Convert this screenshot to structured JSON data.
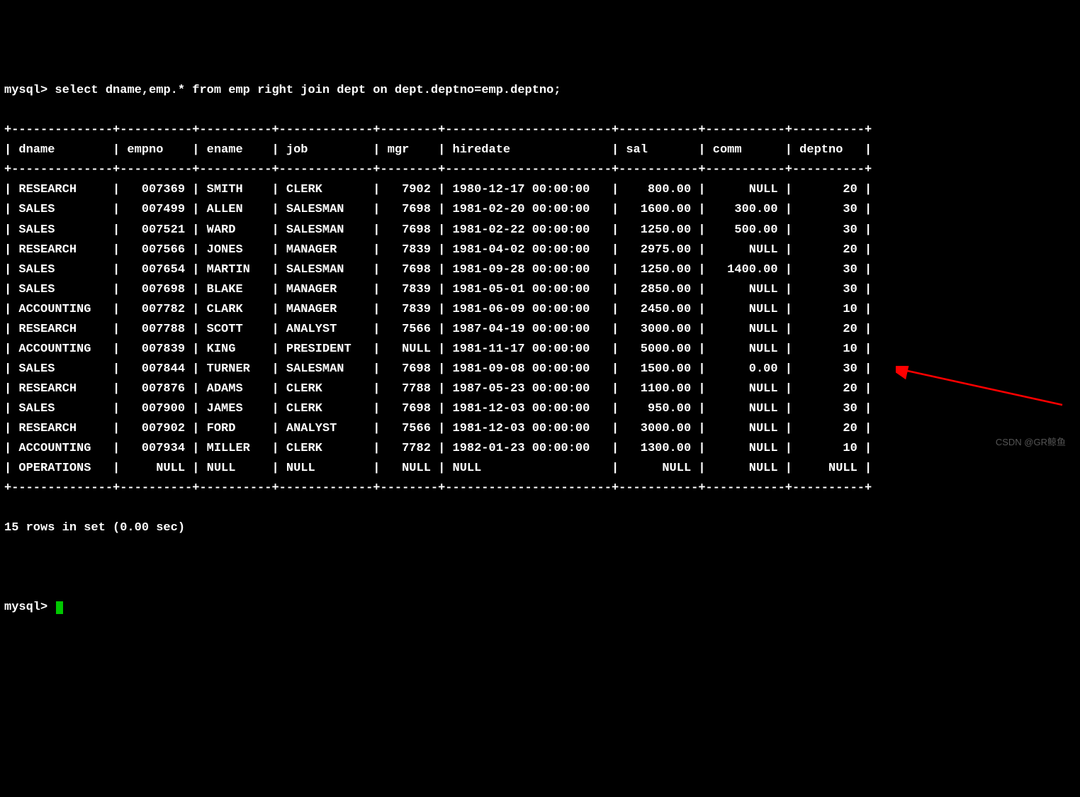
{
  "prompt1_prefix": "mysql> ",
  "query": "select dname,emp.* from emp right join dept on dept.deptno=emp.deptno;",
  "columns": [
    "dname",
    "empno",
    "ename",
    "job",
    "mgr",
    "hiredate",
    "sal",
    "comm",
    "deptno"
  ],
  "widths": [
    12,
    8,
    8,
    11,
    6,
    21,
    9,
    9,
    8
  ],
  "rows": [
    {
      "dname": "RESEARCH",
      "empno": "007369",
      "ename": "SMITH",
      "job": "CLERK",
      "mgr": "7902",
      "hiredate": "1980-12-17 00:00:00",
      "sal": "800.00",
      "comm": "NULL",
      "deptno": "20"
    },
    {
      "dname": "SALES",
      "empno": "007499",
      "ename": "ALLEN",
      "job": "SALESMAN",
      "mgr": "7698",
      "hiredate": "1981-02-20 00:00:00",
      "sal": "1600.00",
      "comm": "300.00",
      "deptno": "30"
    },
    {
      "dname": "SALES",
      "empno": "007521",
      "ename": "WARD",
      "job": "SALESMAN",
      "mgr": "7698",
      "hiredate": "1981-02-22 00:00:00",
      "sal": "1250.00",
      "comm": "500.00",
      "deptno": "30"
    },
    {
      "dname": "RESEARCH",
      "empno": "007566",
      "ename": "JONES",
      "job": "MANAGER",
      "mgr": "7839",
      "hiredate": "1981-04-02 00:00:00",
      "sal": "2975.00",
      "comm": "NULL",
      "deptno": "20"
    },
    {
      "dname": "SALES",
      "empno": "007654",
      "ename": "MARTIN",
      "job": "SALESMAN",
      "mgr": "7698",
      "hiredate": "1981-09-28 00:00:00",
      "sal": "1250.00",
      "comm": "1400.00",
      "deptno": "30"
    },
    {
      "dname": "SALES",
      "empno": "007698",
      "ename": "BLAKE",
      "job": "MANAGER",
      "mgr": "7839",
      "hiredate": "1981-05-01 00:00:00",
      "sal": "2850.00",
      "comm": "NULL",
      "deptno": "30"
    },
    {
      "dname": "ACCOUNTING",
      "empno": "007782",
      "ename": "CLARK",
      "job": "MANAGER",
      "mgr": "7839",
      "hiredate": "1981-06-09 00:00:00",
      "sal": "2450.00",
      "comm": "NULL",
      "deptno": "10"
    },
    {
      "dname": "RESEARCH",
      "empno": "007788",
      "ename": "SCOTT",
      "job": "ANALYST",
      "mgr": "7566",
      "hiredate": "1987-04-19 00:00:00",
      "sal": "3000.00",
      "comm": "NULL",
      "deptno": "20"
    },
    {
      "dname": "ACCOUNTING",
      "empno": "007839",
      "ename": "KING",
      "job": "PRESIDENT",
      "mgr": "NULL",
      "hiredate": "1981-11-17 00:00:00",
      "sal": "5000.00",
      "comm": "NULL",
      "deptno": "10"
    },
    {
      "dname": "SALES",
      "empno": "007844",
      "ename": "TURNER",
      "job": "SALESMAN",
      "mgr": "7698",
      "hiredate": "1981-09-08 00:00:00",
      "sal": "1500.00",
      "comm": "0.00",
      "deptno": "30"
    },
    {
      "dname": "RESEARCH",
      "empno": "007876",
      "ename": "ADAMS",
      "job": "CLERK",
      "mgr": "7788",
      "hiredate": "1987-05-23 00:00:00",
      "sal": "1100.00",
      "comm": "NULL",
      "deptno": "20"
    },
    {
      "dname": "SALES",
      "empno": "007900",
      "ename": "JAMES",
      "job": "CLERK",
      "mgr": "7698",
      "hiredate": "1981-12-03 00:00:00",
      "sal": "950.00",
      "comm": "NULL",
      "deptno": "30"
    },
    {
      "dname": "RESEARCH",
      "empno": "007902",
      "ename": "FORD",
      "job": "ANALYST",
      "mgr": "7566",
      "hiredate": "1981-12-03 00:00:00",
      "sal": "3000.00",
      "comm": "NULL",
      "deptno": "20"
    },
    {
      "dname": "ACCOUNTING",
      "empno": "007934",
      "ename": "MILLER",
      "job": "CLERK",
      "mgr": "7782",
      "hiredate": "1982-01-23 00:00:00",
      "sal": "1300.00",
      "comm": "NULL",
      "deptno": "10"
    },
    {
      "dname": "OPERATIONS",
      "empno": "NULL",
      "ename": "NULL",
      "job": "NULL",
      "mgr": "NULL",
      "hiredate": "NULL",
      "sal": "NULL",
      "comm": "NULL",
      "deptno": "NULL"
    }
  ],
  "left_align": [
    "dname",
    "ename",
    "job",
    "hiredate"
  ],
  "summary": "15 rows in set (0.00 sec)",
  "prompt2": "mysql> ",
  "watermark": "CSDN @GR鲸鱼"
}
